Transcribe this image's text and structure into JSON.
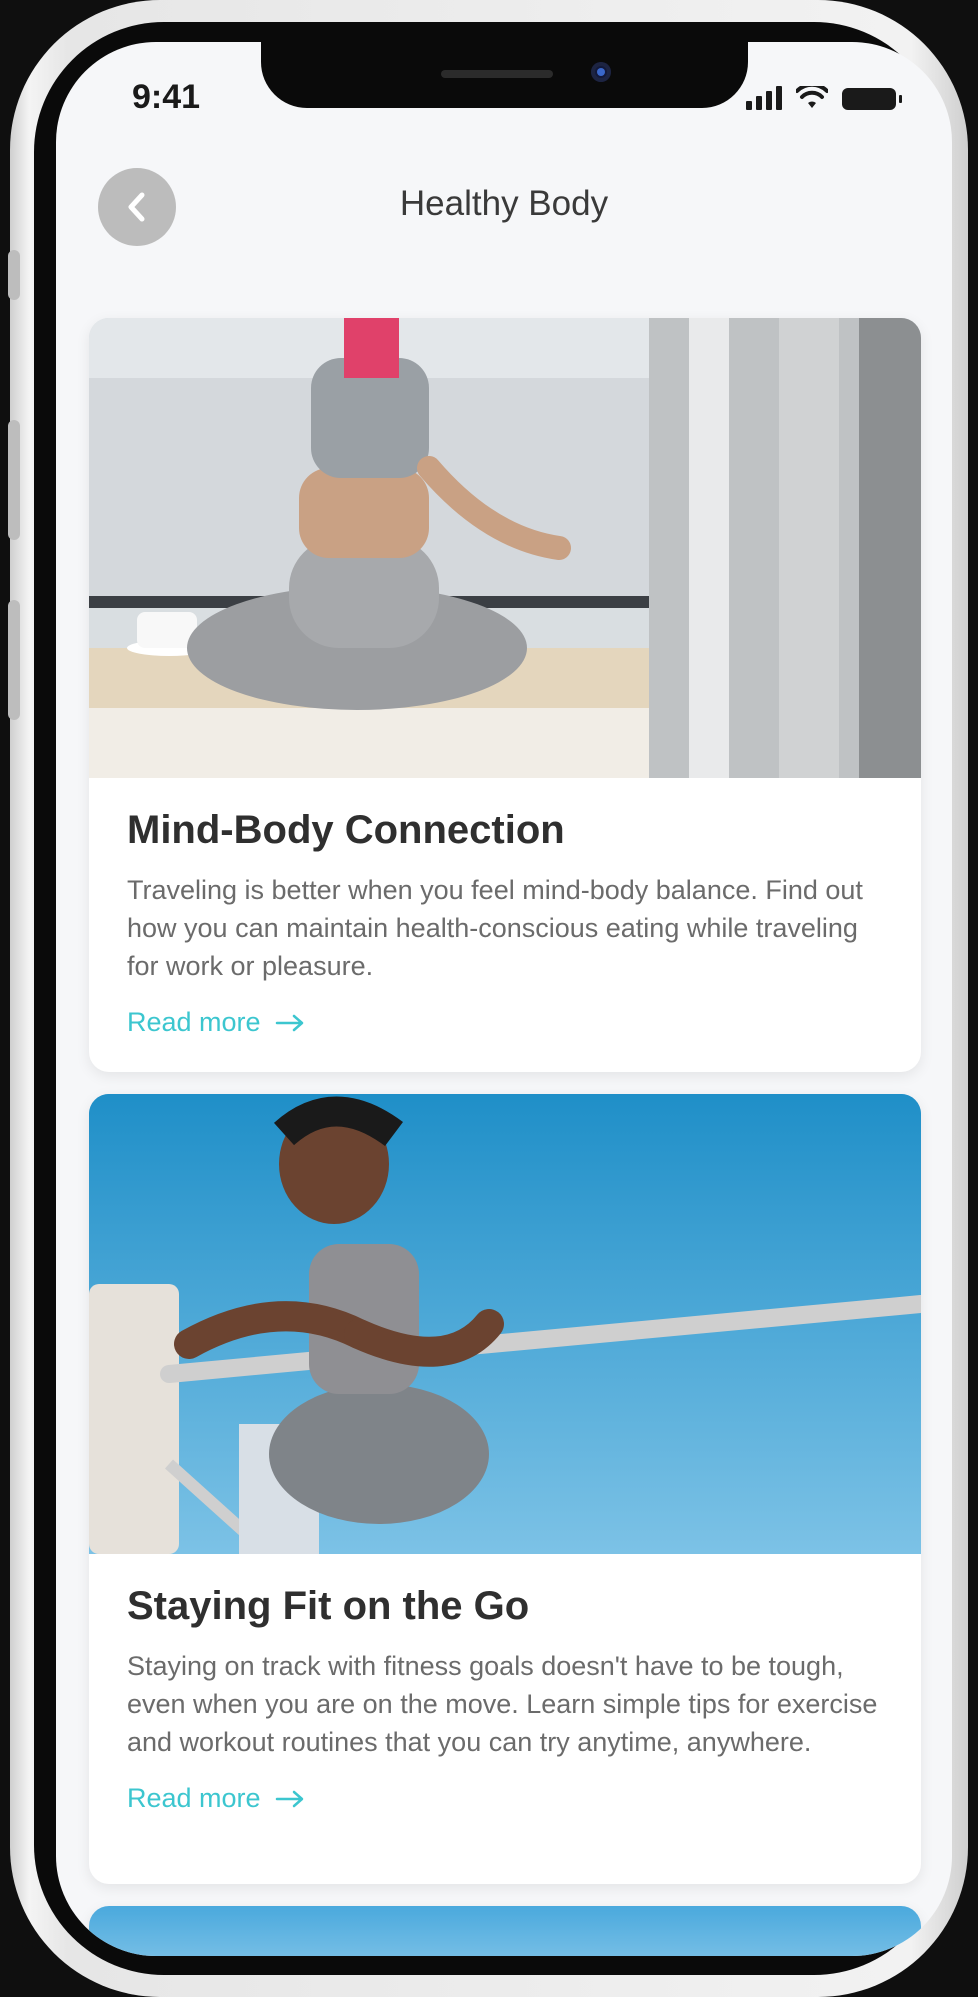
{
  "status_bar": {
    "time": "9:41",
    "signal_icon": "signal-icon",
    "wifi_icon": "wifi-icon",
    "battery_icon": "battery-icon"
  },
  "header": {
    "title": "Healthy Body",
    "back_icon": "chevron-left-icon"
  },
  "articles": [
    {
      "title": "Mind-Body Connection",
      "text": "Traveling is better when you feel mind-body balance. Find out how you can maintain health-conscious eating while traveling for work or pleasure.",
      "link_label": "Read more",
      "image": "woman-meditating-by-window"
    },
    {
      "title": "Staying Fit on the Go",
      "text": "Staying on track with fitness goals doesn't have to be tough, even when you are on the move. Learn simple tips for exercise and workout routines that you can try anytime, anywhere.",
      "link_label": "Read more",
      "image": "woman-stretching-on-railing"
    }
  ],
  "colors": {
    "accent": "#3cc6cf",
    "title": "#2f2f2f",
    "body": "#6b6b6b",
    "background": "#f6f7f9"
  }
}
